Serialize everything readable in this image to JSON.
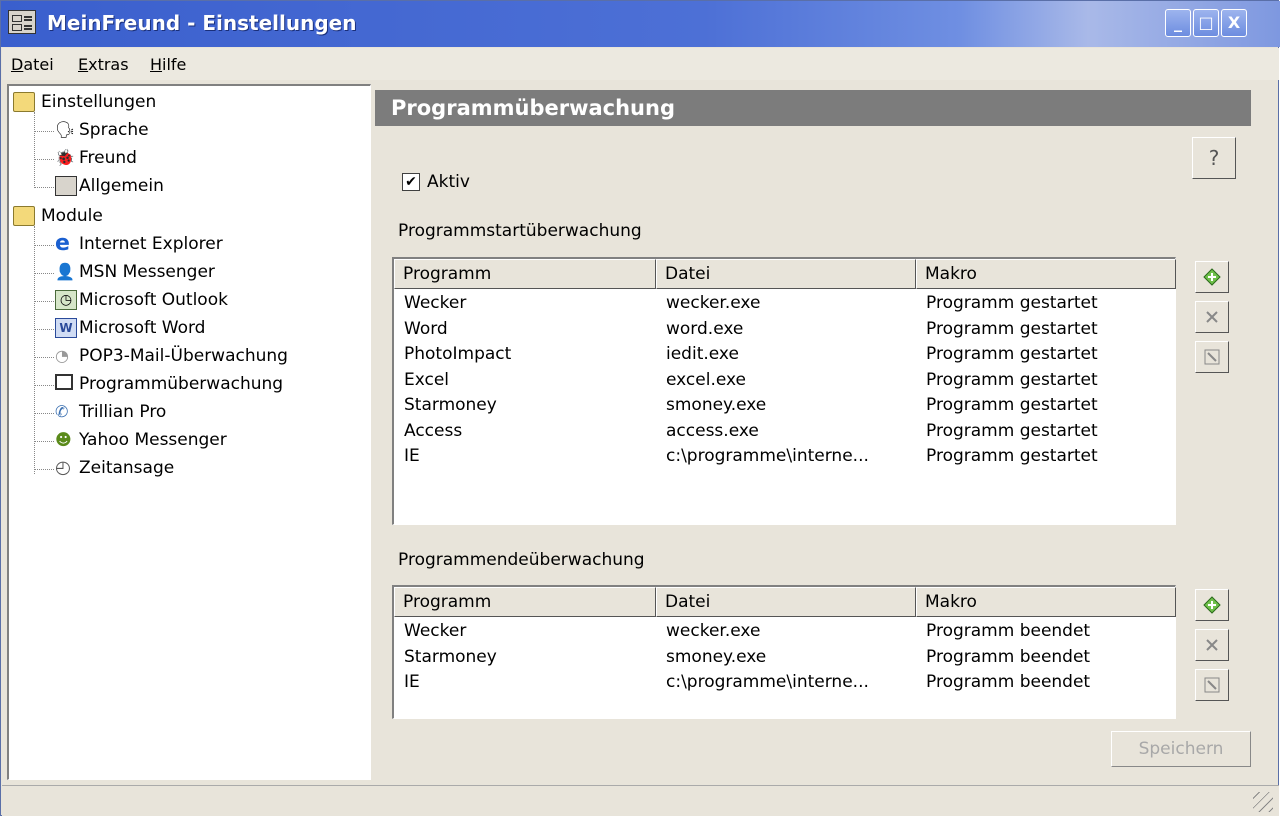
{
  "window": {
    "title": "MeinFreund - Einstellungen"
  },
  "titlebar_buttons": {
    "minimize": "_",
    "maximize": "□",
    "close": "X"
  },
  "menu": [
    {
      "label": "Datei"
    },
    {
      "label": "Extras"
    },
    {
      "label": "Hilfe"
    }
  ],
  "tree": {
    "groups": [
      {
        "label": "Einstellungen",
        "items": [
          "Sprache",
          "Freund",
          "Allgemein"
        ]
      },
      {
        "label": "Module",
        "items": [
          "Internet Explorer",
          "MSN Messenger",
          "Microsoft Outlook",
          "Microsoft Word",
          "POP3-Mail-Überwachung",
          "Programmüberwachung",
          "Trillian Pro",
          "Yahoo Messenger",
          "Zeitansage"
        ]
      }
    ]
  },
  "panel": {
    "title": "Programmüberwachung",
    "help_icon": "help-icon",
    "active_checkbox": {
      "label": "Aktiv",
      "checked": true,
      "mark": "✔"
    },
    "start_section": {
      "label": "Programmstartüberwachung",
      "columns": [
        "Programm",
        "Datei",
        "Makro"
      ],
      "rows": [
        [
          "Wecker",
          "wecker.exe",
          "Programm gestartet"
        ],
        [
          "Word",
          "word.exe",
          "Programm gestartet"
        ],
        [
          "PhotoImpact",
          "iedit.exe",
          "Programm gestartet"
        ],
        [
          "Excel",
          "excel.exe",
          "Programm gestartet"
        ],
        [
          "Starmoney",
          "smoney.exe",
          "Programm gestartet"
        ],
        [
          "Access",
          "access.exe",
          "Programm gestartet"
        ],
        [
          "IE",
          "c:\\programme\\interne...",
          "Programm gestartet"
        ]
      ]
    },
    "end_section": {
      "label": "Programmendeüberwachung",
      "columns": [
        "Programm",
        "Datei",
        "Makro"
      ],
      "rows": [
        [
          "Wecker",
          "wecker.exe",
          "Programm beendet"
        ],
        [
          "Starmoney",
          "smoney.exe",
          "Programm beendet"
        ],
        [
          "IE",
          "c:\\programme\\interne...",
          "Programm beendet"
        ]
      ]
    },
    "save_label": "Speichern"
  }
}
